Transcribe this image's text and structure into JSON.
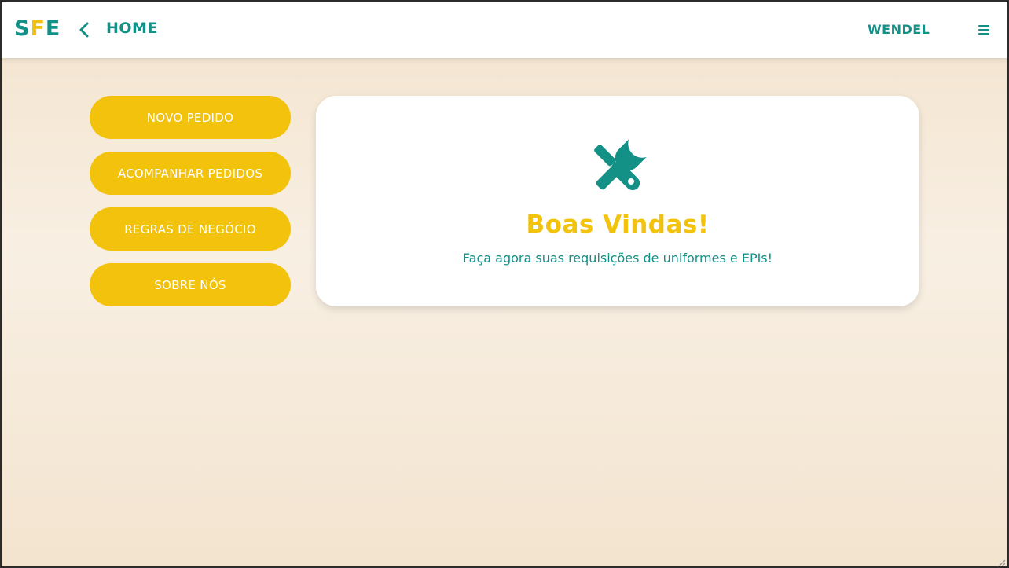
{
  "header": {
    "logo": {
      "letters": [
        "S",
        "F",
        "E"
      ]
    },
    "back_icon": "chevron-left-icon",
    "title": "HOME",
    "user_name": "WENDEL",
    "menu_icon": "hamburger-menu-icon"
  },
  "nav": {
    "items": [
      {
        "label": "NOVO PEDIDO"
      },
      {
        "label": "ACOMPANHAR PEDIDOS"
      },
      {
        "label": "REGRAS DE NEGÓCIO"
      },
      {
        "label": "SOBRE NÓS"
      }
    ]
  },
  "welcome_card": {
    "icon": "tools-icon",
    "title": "Boas Vindas!",
    "subtitle": "Faça agora suas requisições de uniformes e EPIs!"
  },
  "colors": {
    "teal": "#149187",
    "yellow": "#f2c20c",
    "background": "#f5e8d6",
    "card": "#ffffff"
  }
}
